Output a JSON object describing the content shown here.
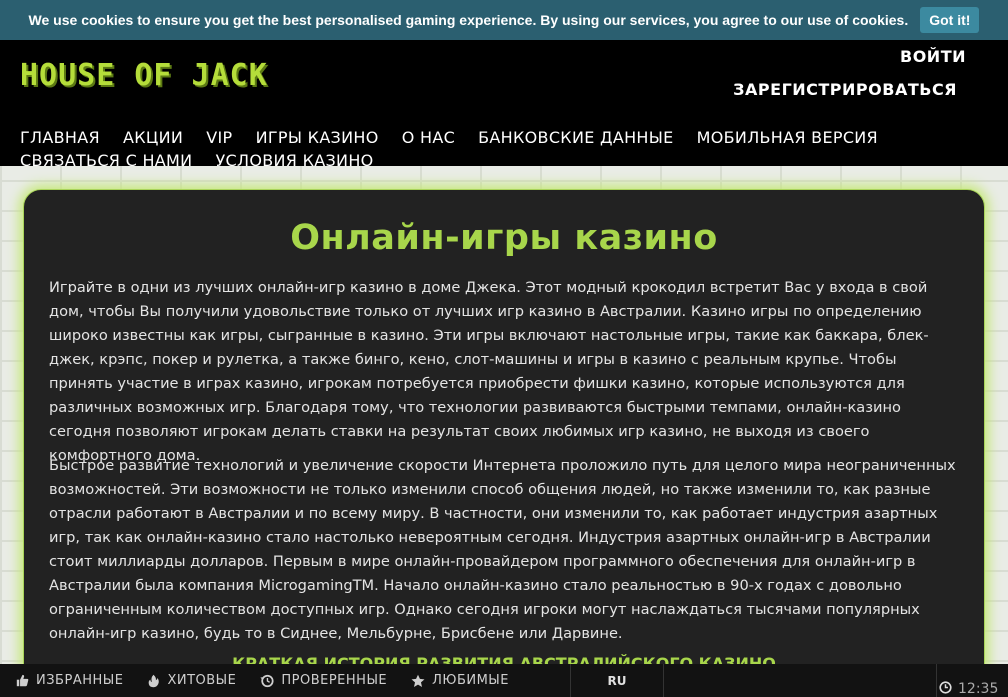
{
  "cookie": {
    "text": "We use cookies to ensure you get the best personalised gaming experience. By using our services, you agree to our use of cookies.",
    "button": "Got it!"
  },
  "header": {
    "logo": "HOUSE OF JACK",
    "login": "ВОЙТИ",
    "register": "ЗАРЕГИСТРИРОВАТЬСЯ",
    "nav": [
      "ГЛАВНАЯ",
      "АКЦИИ",
      "VIP",
      "ИГРЫ КАЗИНО",
      "О НАС",
      "БАНКОВСКИЕ ДАННЫЕ",
      "МОБИЛЬНАЯ ВЕРСИЯ",
      "СВЯЗАТЬСЯ С НАМИ",
      "УСЛОВИЯ КАЗИНО"
    ]
  },
  "main": {
    "title": "Онлайн-игры казино",
    "paragraph1": "Играйте в одни из лучших онлайн-игр казино в доме Джека. Этот модный крокодил встретит Вас у входа в свой дом, чтобы Вы получили удовольствие только от лучших игр казино в Австралии. Казино игры по определению широко известны как игры, сыгранные в казино. Эти игры включают настольные игры, такие как баккара, блек-джек, крэпс, покер и рулетка, а также бинго, кено, слот-машины и игры в казино с реальным крупье. Чтобы принять участие в играх казино, игрокам потребуется приобрести фишки казино, которые используются для различных возможных игр. Благодаря тому, что технологии развиваются быстрыми темпами, онлайн-казино сегодня позволяют игрокам делать ставки на результат своих любимых игр казино, не выходя из своего комфортного дома.",
    "paragraph2": "Быстрое развитие технологий и увеличение скорости Интернета проложило путь для целого мира неограниченных возможностей. Эти возможности не только изменили способ общения людей, но также изменили то, как разные отрасли работают в Австралии и по всему миру. В частности, они изменили то, как работает индустрия азартных игр, так как онлайн-казино стало настолько невероятным сегодня. Индустрия азартных онлайн-игр в Австралии стоит миллиарды долларов. Первым в мире онлайн-провайдером программного обеспечения для онлайн-игр в Австралии была компания MicrogamingTM. Начало онлайн-казино стало реальностью в 90-х годах с довольно ограниченным количеством доступных игр. Однако сегодня игроки могут наслаждаться тысячами популярных онлайн-игр казино, будь то в Сиднее, Мельбурне, Брисбене или Дарвине.",
    "subheading": "КРАТКАЯ ИСТОРИЯ РАЗВИТИЯ АВСТРАЛИЙСКОГО КАЗИНО"
  },
  "bottom_bar": {
    "items": [
      {
        "label": "ИЗБРАННЫЕ",
        "icon": "thumbs-up-icon"
      },
      {
        "label": "ХИТОВЫЕ",
        "icon": "fire-icon"
      },
      {
        "label": "ПРОВЕРЕННЫЕ",
        "icon": "history-icon"
      },
      {
        "label": "ЛЮБИМЫЕ",
        "icon": "star-icon"
      }
    ],
    "language": "RU",
    "time": "12:35"
  },
  "colors": {
    "accent_green": "#a8d64b",
    "cookie_bar": "#2b5f70",
    "header_bg": "#000000",
    "card_bg": "#222222"
  }
}
